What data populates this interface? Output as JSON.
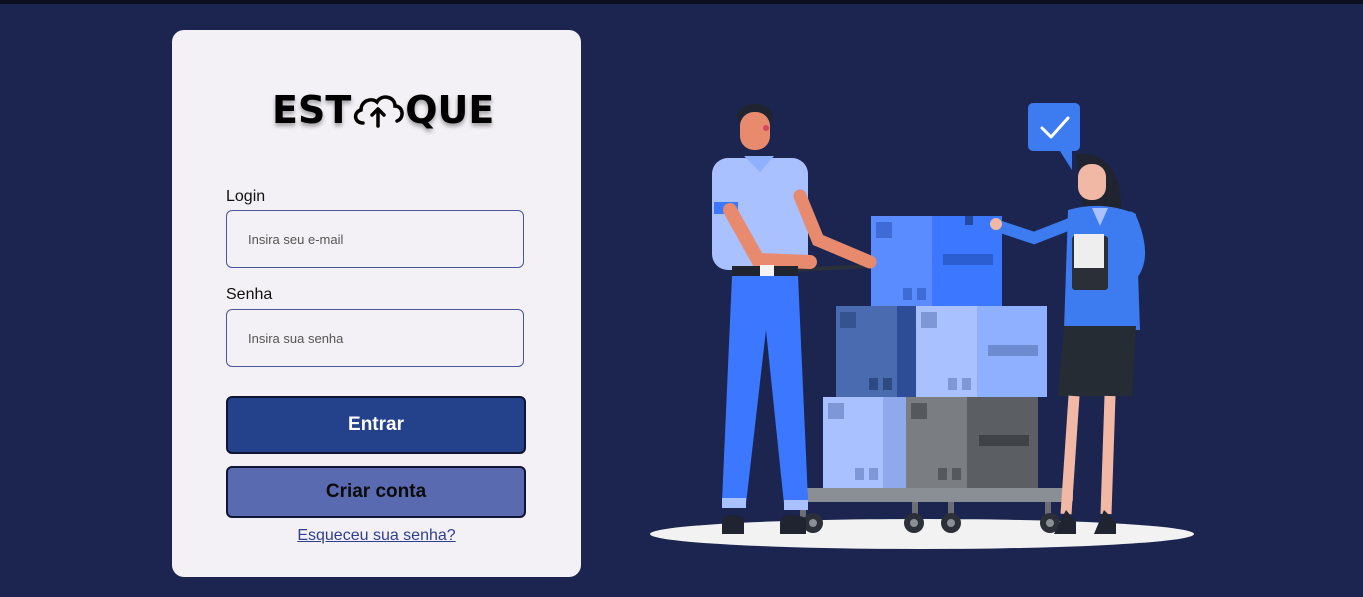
{
  "brand": {
    "logo_left": "EST",
    "logo_right": "QUE",
    "logo_icon": "cloud-upload-icon"
  },
  "form": {
    "login_label": "Login",
    "login_placeholder": "Insira seu e-mail",
    "login_value": "",
    "password_label": "Senha",
    "password_placeholder": "Insira sua senha",
    "password_value": ""
  },
  "actions": {
    "submit_label": "Entrar",
    "create_account_label": "Criar conta",
    "forgot_password_label": "Esqueceu sua senha?"
  },
  "colors": {
    "background": "#1b2550",
    "card": "#f3f1f5",
    "primary_button": "#24418c",
    "secondary_button": "#5a6ab0",
    "link": "#2f3f8f"
  },
  "illustration": {
    "icon": "warehouse-workers-boxes-illustration",
    "badge_icon": "checkmark-icon"
  }
}
